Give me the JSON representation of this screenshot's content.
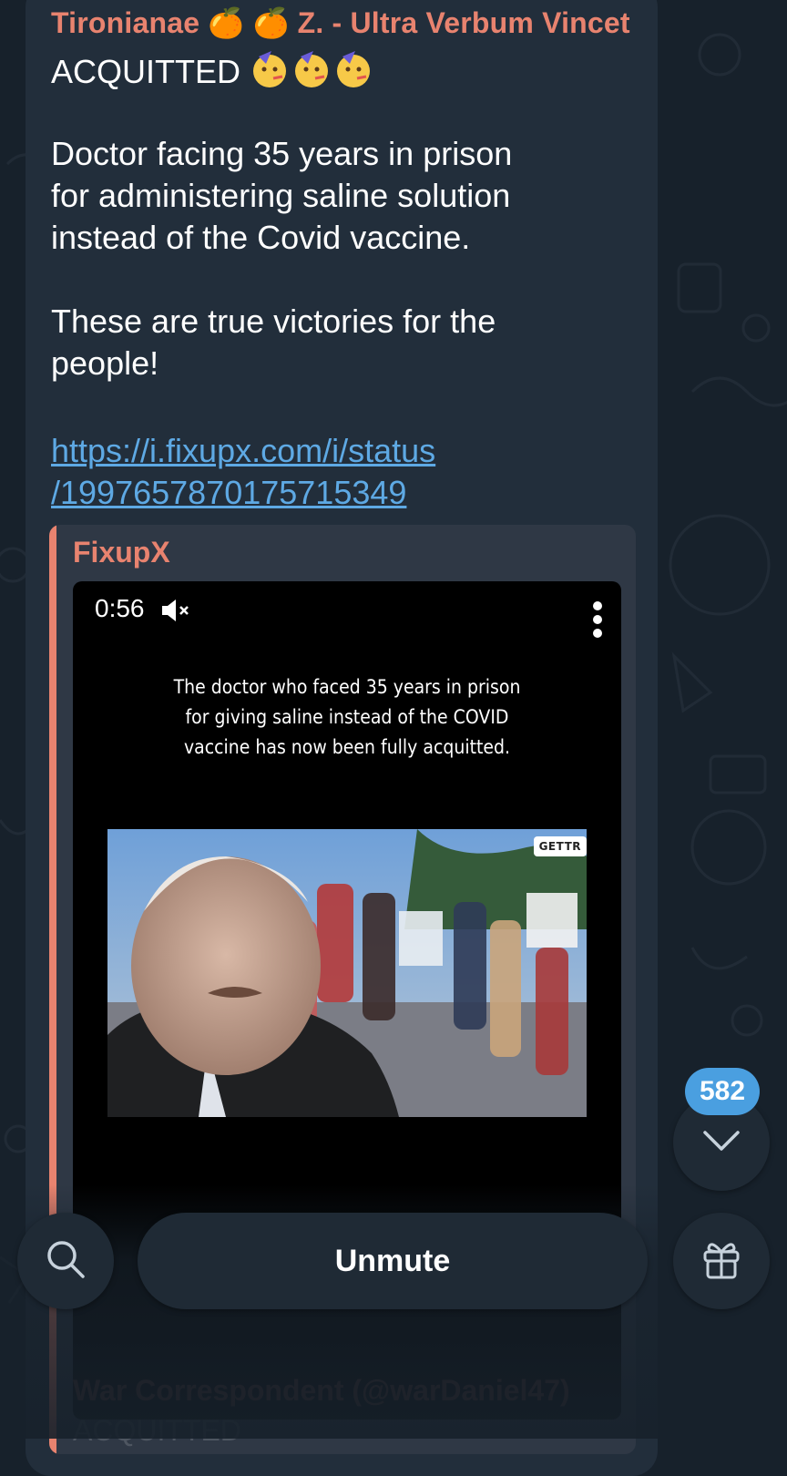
{
  "message": {
    "sender": "Tironianae 🍊 🍊 Z. - Ultra Verbum Vincet",
    "line1": "ACQUITTED",
    "lines": [
      "Doctor facing 35 years in prison",
      "for administering saline solution",
      "instead of the Covid vaccine.",
      "",
      "These are true victories for the",
      "people!"
    ],
    "link_line1": "https://i.fixupx.com/i/status",
    "link_line2": "/1997657870175715349"
  },
  "preview": {
    "site_name": "FixupX",
    "video": {
      "duration": "0:56",
      "caption_lines": [
        "The doctor who faced 35 years in prison",
        "for giving saline instead of the COVID",
        "vaccine has now been fully acquitted."
      ],
      "watermark": "GETTR"
    },
    "next_author": "War Correspondent (@warDaniel47)",
    "next_text": "ACQUITTED"
  },
  "controls": {
    "unmute_label": "Unmute",
    "unread_count": "582",
    "search_icon": "search-icon",
    "gift_icon": "gift-icon",
    "scroll_down_icon": "chevron-down-icon"
  },
  "colors": {
    "background": "#17212b",
    "bubble": "#222e3b",
    "accent_name": "#e8836f",
    "link": "#5ea9e4",
    "badge": "#4a9fe0"
  }
}
